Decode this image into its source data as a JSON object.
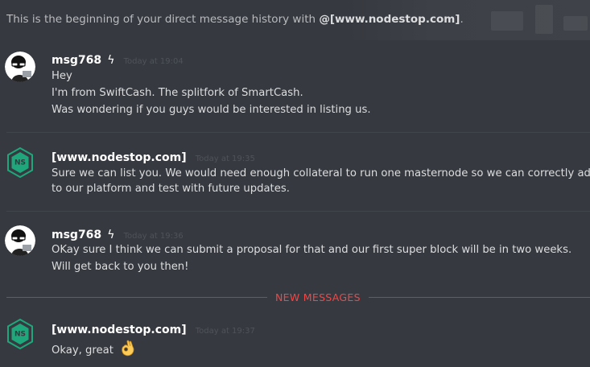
{
  "intro": {
    "prefix": "This is the beginning of your direct message history with",
    "mention": "@[www.nodestop.com]",
    "suffix": "."
  },
  "messages": [
    {
      "author": "msg768",
      "badge": "ϟ",
      "timestamp": "Today at 19:04",
      "lines": [
        "Hey",
        "I'm from SwiftCash. The splitfork of SmartCash.",
        "Was wondering if you guys would be interested in listing us."
      ]
    },
    {
      "author": "[www.nodestop.com]",
      "timestamp": "Today at 19:35",
      "lines": [
        "Sure we can list you. We would need enough collateral to run one masternode so we can correctly add your coin",
        "to our platform and test with future updates."
      ]
    },
    {
      "author": "msg768",
      "badge": "ϟ",
      "timestamp": "Today at 19:36",
      "lines": [
        "OKay sure I think we can submit a proposal for that and our first super block will be in two weeks.",
        "Will get back to you then!"
      ]
    },
    {
      "author": "[www.nodestop.com]",
      "timestamp": "Today at 19:37",
      "lines": [
        "Okay, great"
      ],
      "emoji": "ok-hand"
    }
  ],
  "new_messages_label": "NEW MESSAGES",
  "colors": {
    "background": "#36393f",
    "new_messages": "#f04747",
    "nodestop_green": "#1fa67a"
  }
}
